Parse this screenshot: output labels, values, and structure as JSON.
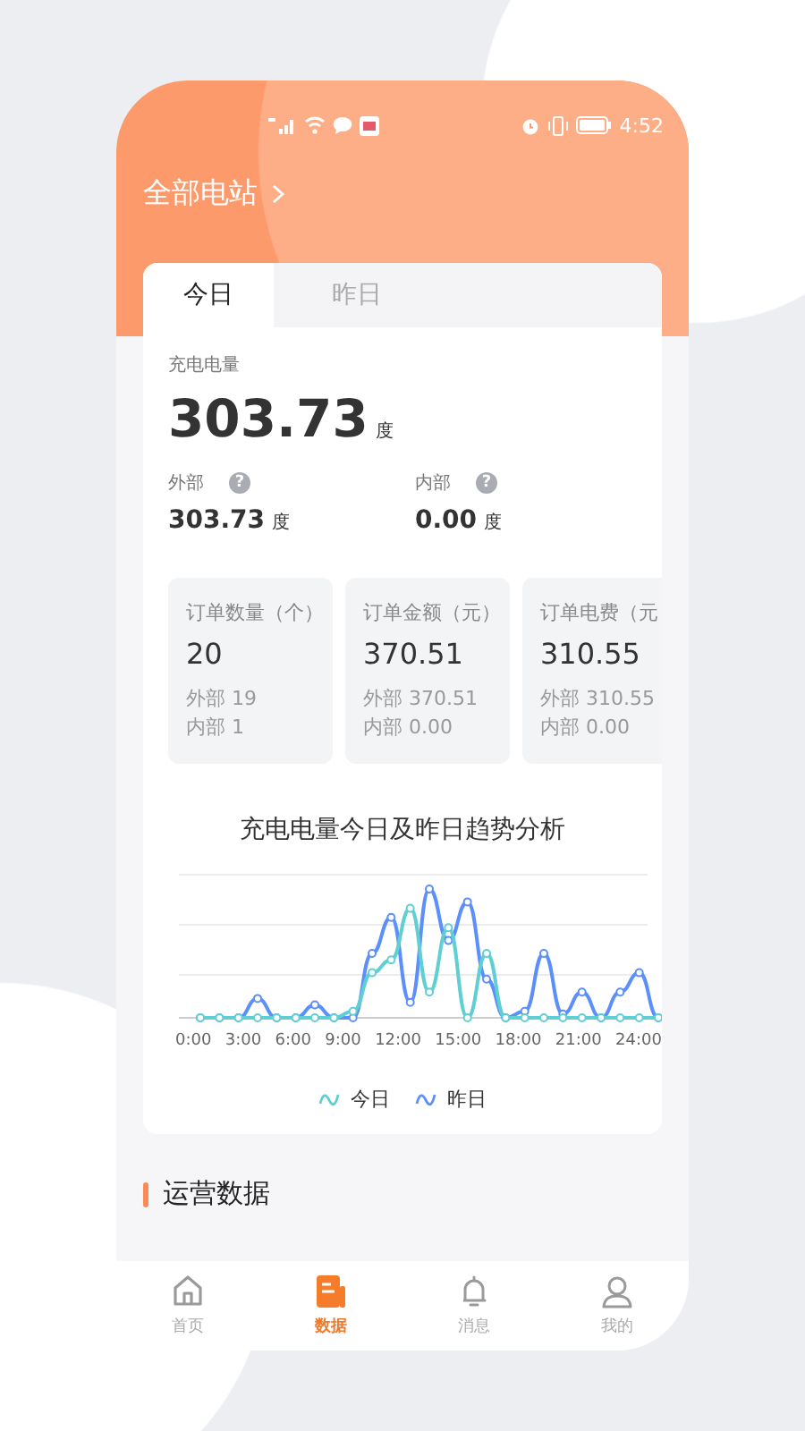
{
  "status_bar": {
    "time": "4:52"
  },
  "header": {
    "title": "全部电站"
  },
  "tabs": [
    {
      "label": "今日",
      "selected": true
    },
    {
      "label": "昨日",
      "selected": false
    }
  ],
  "total": {
    "label": "充电电量",
    "value": "303.73",
    "unit": "度"
  },
  "split": [
    {
      "label": "外部",
      "help": "?",
      "value": "303.73",
      "unit": "度"
    },
    {
      "label": "内部",
      "help": "?",
      "value": "0.00",
      "unit": "度"
    }
  ],
  "stat_cards": [
    {
      "title": "订单数量（个）",
      "value": "20",
      "lines": [
        "外部 19",
        "内部 1"
      ]
    },
    {
      "title": "订单金额（元）",
      "value": "370.51",
      "lines": [
        "外部 370.51",
        "内部 0.00"
      ]
    },
    {
      "title": "订单电费（元",
      "value": "310.55",
      "lines": [
        "外部 310.55",
        "内部 0.00"
      ]
    }
  ],
  "chart": {
    "title": "充电电量今日及昨日趋势分析",
    "x_labels": [
      "0:00",
      "3:00",
      "6:00",
      "9:00",
      "12:00",
      "15:00",
      "18:00",
      "21:00",
      "24:00"
    ],
    "legend": [
      {
        "label": "今日",
        "color": "#5fcfd4"
      },
      {
        "label": "昨日",
        "color": "#5b8ff9"
      }
    ]
  },
  "section": {
    "title": "运营数据"
  },
  "nav": [
    {
      "label": "首页",
      "kind": "home",
      "selected": false
    },
    {
      "label": "数据",
      "kind": "data",
      "selected": true
    },
    {
      "label": "消息",
      "kind": "bell",
      "selected": false
    },
    {
      "label": "我的",
      "kind": "user",
      "selected": false
    }
  ]
}
